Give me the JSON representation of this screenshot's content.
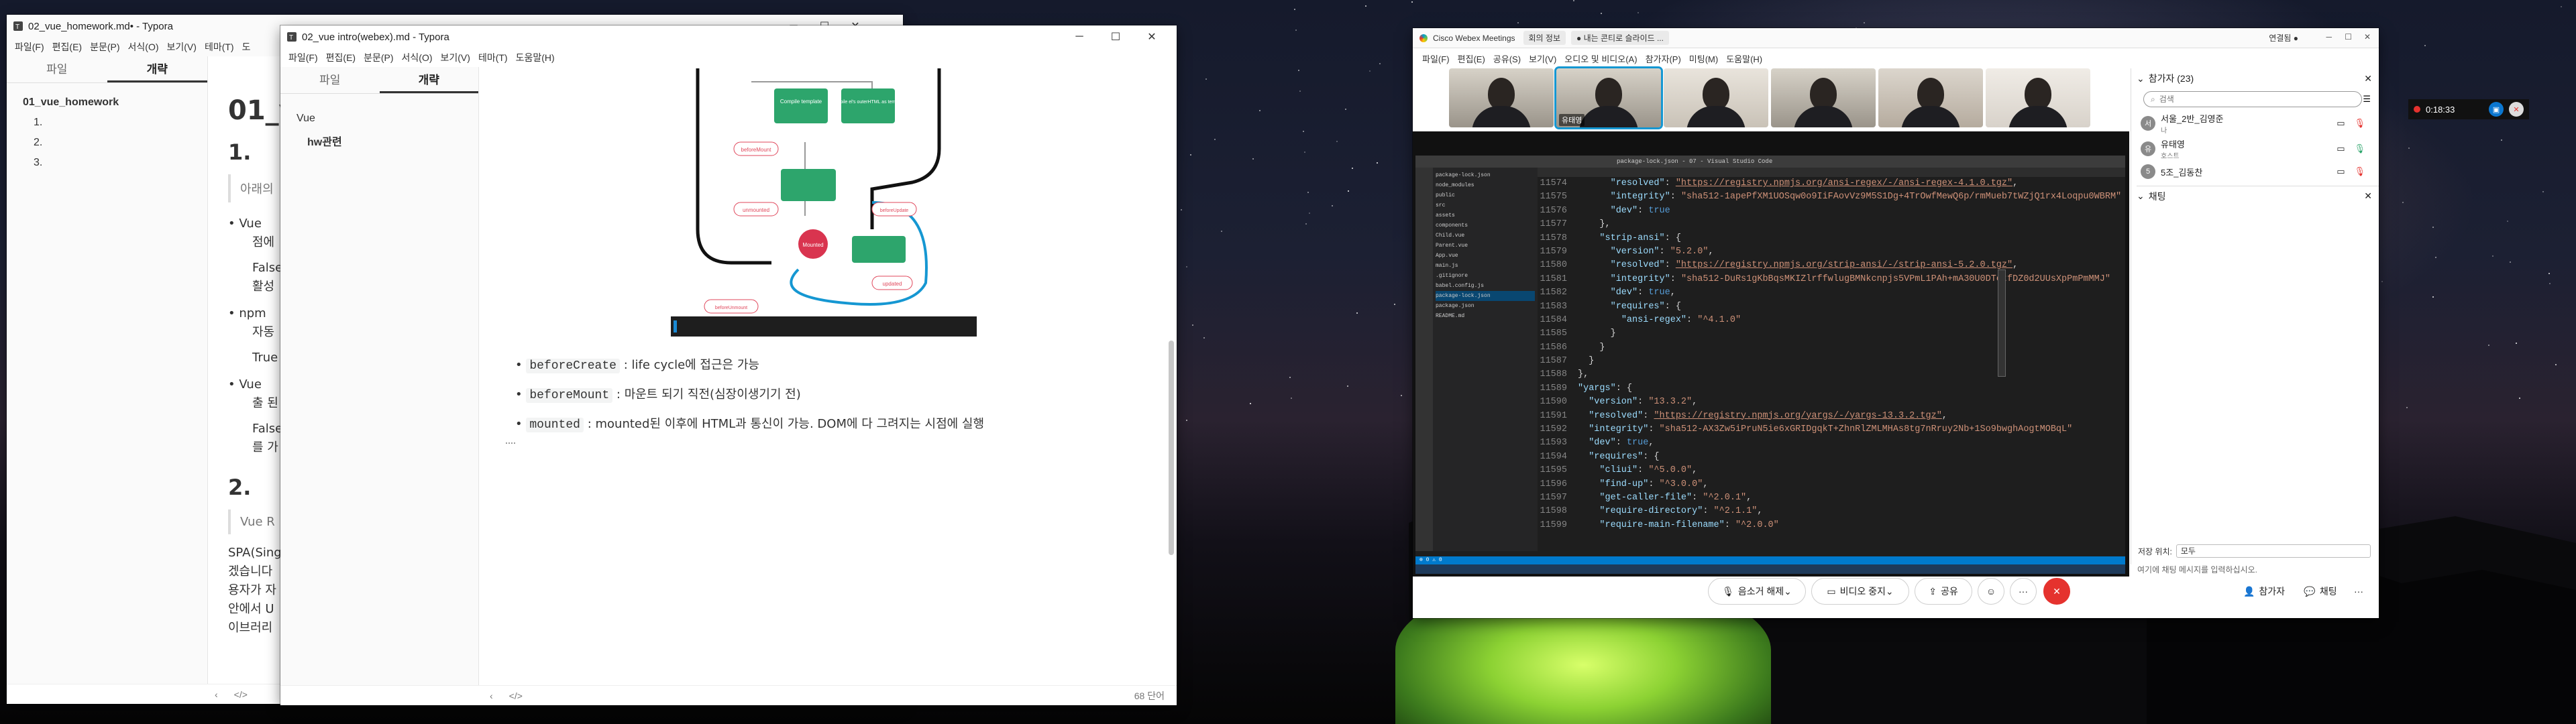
{
  "typora_back": {
    "title": "02_vue_homework.md• - Typora",
    "menu": [
      "파일(F)",
      "편집(E)",
      "분문(P)",
      "서식(O)",
      "보기(V)",
      "테마(T)",
      "도"
    ],
    "tabs": [
      "파일",
      "개략"
    ],
    "outline": [
      "01_vue_homework",
      "1.",
      "2.",
      "3."
    ],
    "h1": "01_v",
    "h2_1": "1.",
    "quote1": "아래의",
    "bullets": [
      "Vue",
      "npm",
      "Vue"
    ],
    "sub_lines": [
      "점에",
      "False",
      "활성",
      "자동",
      "True",
      "출 된",
      "False",
      "를 가"
    ],
    "h2_2": "2.",
    "quote2": "Vue R",
    "para": [
      "SPA(Sing",
      "겠습니다",
      "용자가 자",
      "안에서 U",
      "이브러리"
    ],
    "status_code": "</>"
  },
  "typora_front": {
    "title": "02_vue intro(webex).md - Typora",
    "menu": [
      "파일(F)",
      "편집(E)",
      "분문(P)",
      "서식(O)",
      "보기(V)",
      "테마(T)",
      "도움말(H)"
    ],
    "tabs": [
      "파일",
      "개략"
    ],
    "outline_root": "Vue",
    "outline_child": "hw관련",
    "list": [
      {
        "code": "beforeCreate",
        "text": ": life cycle에 접근은 가능"
      },
      {
        "code": "beforeMount",
        "text": ": 마운트 되기 직전(심장이생기기 전)"
      },
      {
        "code": "mounted",
        "text": ": mounted된 이후에 HTML과 통신이 가능. DOM에 다 그려지는 시점에 실행"
      }
    ],
    "word_count": "68 단어",
    "status_code": "</>",
    "diagram_labels": [
      "beforeMount",
      "unmounted",
      "beforeUnmount",
      "updated",
      "beforeUpdate",
      "Mounted",
      "Compile template",
      "Compile el's outerHTML as template"
    ]
  },
  "webex": {
    "title": "Cisco Webex Meetings",
    "tab_meeting": "회의 정보",
    "tab_share": "● 내는 콘티로 슬라이드 ...",
    "connected": "연결됨 ●",
    "menu": [
      "파일(F)",
      "편집(E)",
      "공유(S)",
      "보기(V)",
      "오디오 및 비디오(A)",
      "참가자(P)",
      "미팅(M)",
      "도움말(H)"
    ],
    "video_labels": [
      "",
      "유태영",
      "",
      "",
      "",
      ""
    ],
    "participants_title": "참가자 (23)",
    "search_placeholder": "검색",
    "participants": [
      {
        "name": "서울_2반_김영준",
        "role": "나",
        "initial": "서"
      },
      {
        "name": "유태영",
        "role": "호스트",
        "initial": "유"
      },
      {
        "name": "5조_김동찬",
        "role": "",
        "initial": "5"
      }
    ],
    "chat_title": "채팅",
    "chat_to_label": "저장 위치:",
    "chat_to_value": "모두",
    "chat_placeholder": "여기에 채팅 메시지를 입력하십시오.",
    "controls": {
      "mute": "음소거 해제",
      "video": "비디오 중지",
      "share": "공유",
      "participants": "참가자",
      "chat": "채팅"
    },
    "timer": "0:18:33"
  },
  "vscode": {
    "title": "package-lock.json - 07 - Visual Studio Code",
    "status_left": "⊗ 0 ⚠ 0",
    "lines": [
      {
        "n": "11574",
        "parts": [
          [
            "p",
            "      "
          ],
          [
            "k",
            "\"resolved\""
          ],
          [
            "p",
            ": "
          ],
          [
            "u",
            "\"https://registry.npmjs.org/ansi-regex/-/ansi-regex-4.1.0.tgz\""
          ],
          [
            "p",
            ","
          ]
        ]
      },
      {
        "n": "11575",
        "parts": [
          [
            "p",
            "      "
          ],
          [
            "k",
            "\"integrity\""
          ],
          [
            "p",
            ": "
          ],
          [
            "s",
            "\"sha512-1apePfXM1UOSqw0o9IiFAovVz9M5S1Dg+4TrOwfMewQ6p/rmMueb7tWZjQ1rx4Loqpu0WBRM\""
          ]
        ]
      },
      {
        "n": "11576",
        "parts": [
          [
            "p",
            "      "
          ],
          [
            "k",
            "\"dev\""
          ],
          [
            "p",
            ": "
          ],
          [
            "b",
            "true"
          ]
        ]
      },
      {
        "n": "11577",
        "parts": [
          [
            "p",
            "    },"
          ]
        ]
      },
      {
        "n": "11578",
        "parts": [
          [
            "p",
            "    "
          ],
          [
            "k",
            "\"strip-ansi\""
          ],
          [
            "p",
            ": {"
          ]
        ]
      },
      {
        "n": "11579",
        "parts": [
          [
            "p",
            "      "
          ],
          [
            "k",
            "\"version\""
          ],
          [
            "p",
            ": "
          ],
          [
            "s",
            "\"5.2.0\""
          ],
          [
            "p",
            ","
          ]
        ]
      },
      {
        "n": "11580",
        "parts": [
          [
            "p",
            "      "
          ],
          [
            "k",
            "\"resolved\""
          ],
          [
            "p",
            ": "
          ],
          [
            "u",
            "\"https://registry.npmjs.org/strip-ansi/-/strip-ansi-5.2.0.tgz\""
          ],
          [
            "p",
            ","
          ]
        ]
      },
      {
        "n": "11581",
        "parts": [
          [
            "p",
            "      "
          ],
          [
            "k",
            "\"integrity\""
          ],
          [
            "p",
            ": "
          ],
          [
            "s",
            "\"sha512-DuRs1gKbBqsMKIZlrffwlugBMNkcnpjs5VPmL1PAh+mA30U0DTotfDZ0d2UUsXpPmPmMMJ\""
          ]
        ]
      },
      {
        "n": "11582",
        "parts": [
          [
            "p",
            "      "
          ],
          [
            "k",
            "\"dev\""
          ],
          [
            "p",
            ": "
          ],
          [
            "b",
            "true"
          ],
          [
            "p",
            ","
          ]
        ]
      },
      {
        "n": "11583",
        "parts": [
          [
            "p",
            "      "
          ],
          [
            "k",
            "\"requires\""
          ],
          [
            "p",
            ": {"
          ]
        ]
      },
      {
        "n": "11584",
        "parts": [
          [
            "p",
            "        "
          ],
          [
            "k",
            "\"ansi-regex\""
          ],
          [
            "p",
            ": "
          ],
          [
            "s",
            "\"^4.1.0\""
          ]
        ]
      },
      {
        "n": "11585",
        "parts": [
          [
            "p",
            "      }"
          ]
        ]
      },
      {
        "n": "11586",
        "parts": [
          [
            "p",
            "    }"
          ]
        ]
      },
      {
        "n": "11587",
        "parts": [
          [
            "p",
            "  }"
          ]
        ]
      },
      {
        "n": "11588",
        "parts": [
          [
            "p",
            "},"
          ]
        ]
      },
      {
        "n": "11589",
        "parts": [
          [
            "k",
            "\"yargs\""
          ],
          [
            "p",
            ": {"
          ]
        ]
      },
      {
        "n": "11590",
        "parts": [
          [
            "p",
            "  "
          ],
          [
            "k",
            "\"version\""
          ],
          [
            "p",
            ": "
          ],
          [
            "s",
            "\"13.3.2\""
          ],
          [
            "p",
            ","
          ]
        ]
      },
      {
        "n": "11591",
        "parts": [
          [
            "p",
            "  "
          ],
          [
            "k",
            "\"resolved\""
          ],
          [
            "p",
            ": "
          ],
          [
            "u",
            "\"https://registry.npmjs.org/yargs/-/yargs-13.3.2.tgz\""
          ],
          [
            "p",
            ","
          ]
        ]
      },
      {
        "n": "11592",
        "parts": [
          [
            "p",
            "  "
          ],
          [
            "k",
            "\"integrity\""
          ],
          [
            "p",
            ": "
          ],
          [
            "s",
            "\"sha512-AX3Zw5iPruN5ie6xGRIDgqkT+ZhnRlZMLMHAs8tg7nRruy2Nb+1So9bwghAogtMOBqL\""
          ]
        ]
      },
      {
        "n": "11593",
        "parts": [
          [
            "p",
            "  "
          ],
          [
            "k",
            "\"dev\""
          ],
          [
            "p",
            ": "
          ],
          [
            "b",
            "true"
          ],
          [
            "p",
            ","
          ]
        ]
      },
      {
        "n": "11594",
        "parts": [
          [
            "p",
            "  "
          ],
          [
            "k",
            "\"requires\""
          ],
          [
            "p",
            ": {"
          ]
        ]
      },
      {
        "n": "11595",
        "parts": [
          [
            "p",
            "    "
          ],
          [
            "k",
            "\"cliui\""
          ],
          [
            "p",
            ": "
          ],
          [
            "s",
            "\"^5.0.0\""
          ],
          [
            "p",
            ","
          ]
        ]
      },
      {
        "n": "11596",
        "parts": [
          [
            "p",
            "    "
          ],
          [
            "k",
            "\"find-up\""
          ],
          [
            "p",
            ": "
          ],
          [
            "s",
            "\"^3.0.0\""
          ],
          [
            "p",
            ","
          ]
        ]
      },
      {
        "n": "11597",
        "parts": [
          [
            "p",
            "    "
          ],
          [
            "k",
            "\"get-caller-file\""
          ],
          [
            "p",
            ": "
          ],
          [
            "s",
            "\"^2.0.1\""
          ],
          [
            "p",
            ","
          ]
        ]
      },
      {
        "n": "11598",
        "parts": [
          [
            "p",
            "    "
          ],
          [
            "k",
            "\"require-directory\""
          ],
          [
            "p",
            ": "
          ],
          [
            "s",
            "\"^2.1.1\""
          ],
          [
            "p",
            ","
          ]
        ]
      },
      {
        "n": "11599",
        "parts": [
          [
            "p",
            "    "
          ],
          [
            "k",
            "\"require-main-filename\""
          ],
          [
            "p",
            ": "
          ],
          [
            "s",
            "\"^2.0.0\""
          ]
        ]
      }
    ],
    "explorer": [
      "package-lock.json",
      "node_modules",
      "public",
      "src",
      "assets",
      "components",
      "Child.vue",
      "Parent.vue",
      "App.vue",
      "main.js",
      ".gitignore",
      "babel.config.js",
      "package-lock.json",
      "package.json",
      "README.md"
    ]
  },
  "colors": {
    "webex_red": "#e5322e",
    "webex_blue": "#0b77d0",
    "vscode_bg": "#1e1e1e",
    "lifecycle_green": "#2da56c"
  }
}
